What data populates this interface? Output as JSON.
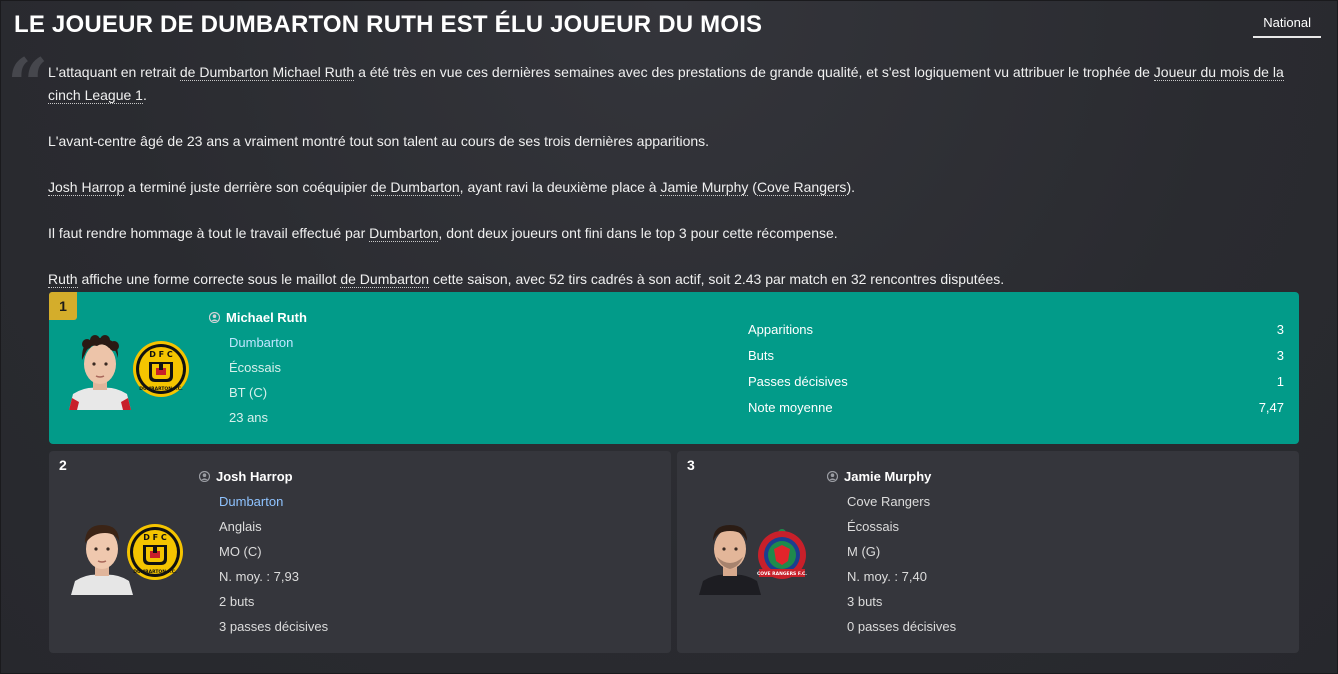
{
  "header": {
    "title": "LE JOUEUR DE DUMBARTON RUTH EST ÉLU JOUEUR DU MOIS",
    "tab_label": "National"
  },
  "article": {
    "p1": {
      "t1": "L'attaquant en retrait ",
      "l1": "de Dumbarton",
      "t2": " ",
      "l2": "Michael Ruth",
      "t3": " a été très en vue ces dernières semaines avec des prestations de grande qualité, et s'est logiquement vu attribuer le trophée de ",
      "l3": "Joueur du mois de la cinch League 1",
      "t4": "."
    },
    "p2": "L'avant-centre âgé de 23 ans a vraiment montré tout son talent au cours de ses trois dernières apparitions.",
    "p3": {
      "l1": "Josh Harrop",
      "t1": " a terminé juste derrière son coéquipier ",
      "l2": "de Dumbarton",
      "t2": ", ayant ravi la deuxième place à ",
      "l3": "Jamie Murphy",
      "t3": " (",
      "l4": "Cove Rangers",
      "t4": ")."
    },
    "p4": {
      "t1": "Il faut rendre hommage à tout le travail effectué par ",
      "l1": "Dumbarton",
      "t2": ", dont deux joueurs ont fini dans le top 3 pour cette récompense."
    },
    "p5": {
      "l1": "Ruth",
      "t1": " affiche une forme correcte sous le maillot ",
      "l2": "de Dumbarton",
      "t2": " cette saison, avec 52 tirs cadrés à son actif, soit 2.43 par match en 32 rencontres disputées."
    }
  },
  "winner": {
    "rank": "1",
    "name": "Michael Ruth",
    "club": "Dumbarton",
    "nationality": "Écossais",
    "position": "BT (C)",
    "age": "23 ans",
    "stats": [
      {
        "label": "Apparitions",
        "value": "3"
      },
      {
        "label": "Buts",
        "value": "3"
      },
      {
        "label": "Passes décisives",
        "value": "1"
      },
      {
        "label": "Note moyenne",
        "value": "7,47"
      }
    ]
  },
  "second": {
    "rank": "2",
    "name": "Josh Harrop",
    "club": "Dumbarton",
    "nationality": "Anglais",
    "position": "MO (C)",
    "rating": "N. moy. : 7,93",
    "goals": "2 buts",
    "assists": "3 passes décisives"
  },
  "third": {
    "rank": "3",
    "name": "Jamie Murphy",
    "club": "Cove Rangers",
    "nationality": "Écossais",
    "position": "M (G)",
    "rating": "N. moy. : 7,40",
    "goals": "3 buts",
    "assists": "0 passes décisives"
  },
  "crests": {
    "dumbarton_letters": "D F C",
    "dumbarton_text": "DUMBARTON F.C.",
    "cove_text": "COVE RANGERS F.C."
  },
  "colors": {
    "winner_card": "#029b89",
    "rank_badge": "#d4ad2b",
    "card_bg": "#35363c",
    "link": "#8fc3ff"
  }
}
